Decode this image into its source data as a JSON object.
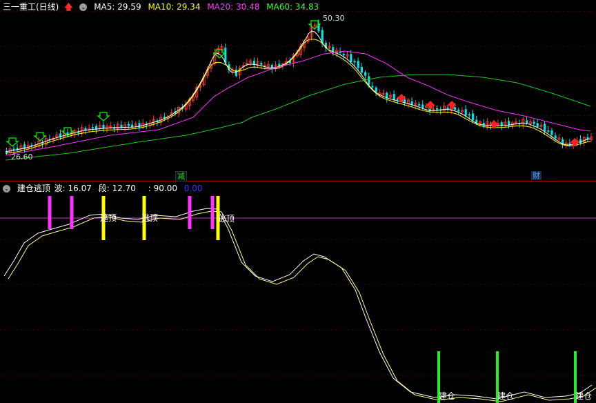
{
  "main_header": {
    "title": "三一重工(日线)",
    "ma5_label": "MA5: 29.59",
    "ma10_label": "MA10: 29.34",
    "ma20_label": "MA20: 30.48",
    "ma60_label": "MA60: 34.83",
    "colors": {
      "title": "#ffffff",
      "ma5": "#ffffff",
      "ma10": "#ffff00",
      "ma20": "#ff00ff",
      "ma60": "#00ff00"
    }
  },
  "price_annotations": {
    "high": "50.30",
    "low": "26.60"
  },
  "x_badges": {
    "left": "减",
    "right": "财"
  },
  "sub_header": {
    "title": "建仓逃顶",
    "wave_label": "波: 16.07",
    "segment_label": "段: 12.70",
    "level_label": ": 90.00",
    "zero_label": "0.00"
  },
  "signal_labels": {
    "escape": "逃顶",
    "build": "建仓"
  },
  "icons": [
    "collapse-circle-icon",
    "up-arrow-icon",
    "buy-arrow-icon",
    "sell-arrow-icon"
  ],
  "chart_data": [
    {
      "type": "candlestick",
      "title": "三一重工(日线)",
      "series": [
        {
          "name": "MA5",
          "last": 29.59,
          "color": "#ffffff"
        },
        {
          "name": "MA10",
          "last": 29.34,
          "color": "#ffff00"
        },
        {
          "name": "MA20",
          "last": 30.48,
          "color": "#ff00ff"
        },
        {
          "name": "MA60",
          "last": 34.83,
          "color": "#00ff00"
        }
      ],
      "annotations": [
        "50.30",
        "26.60"
      ],
      "grid": true
    },
    {
      "type": "line",
      "title": "建仓逃顶",
      "series": [
        {
          "name": "波",
          "last": 16.07,
          "color": "#ffffff"
        },
        {
          "name": "段",
          "last": 12.7,
          "color": "#ffffff"
        }
      ],
      "reference_line": 90.0,
      "ylim": [
        0,
        100
      ],
      "grid": true,
      "signals": [
        {
          "label": "逃顶",
          "count": 3
        },
        {
          "label": "建仓",
          "count": 3
        }
      ]
    }
  ]
}
